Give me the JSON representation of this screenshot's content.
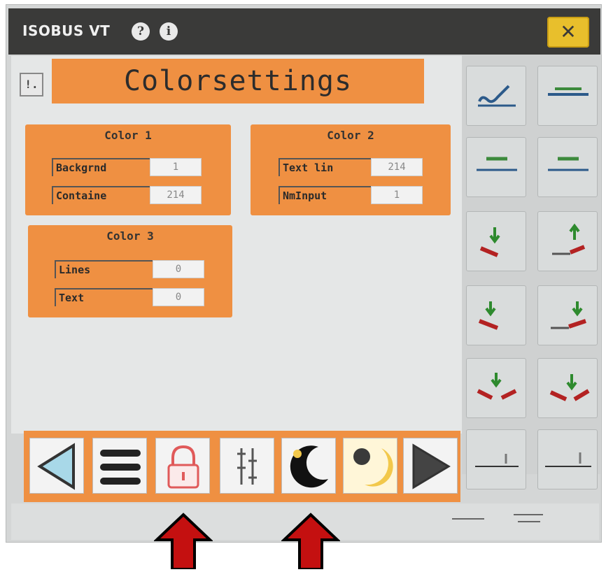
{
  "window": {
    "title": "ISOBUS VT",
    "help_icon": "question-circle-icon",
    "info_icon": "info-circle-icon",
    "close_label": "✕"
  },
  "page": {
    "info_button": "!.",
    "header": "Colorsettings"
  },
  "panels": [
    {
      "title": "Color 1",
      "fields": [
        {
          "label": "Backgrnd",
          "value": "1"
        },
        {
          "label": "Containe",
          "value": "214"
        }
      ]
    },
    {
      "title": "Color 2",
      "fields": [
        {
          "label": "Text lin",
          "value": "214"
        },
        {
          "label": "NmInput",
          "value": "1"
        }
      ]
    },
    {
      "title": "Color 3",
      "fields": [
        {
          "label": "Lines",
          "value": "0"
        },
        {
          "label": "Text",
          "value": "0"
        }
      ]
    }
  ],
  "softkeys": [
    "check-signature-icon",
    "boom-flat-icon",
    "boom-level-left-icon",
    "boom-level-right-icon",
    "left-section-down-icon",
    "right-section-up-icon",
    "left-section-lower-icon",
    "right-section-lower-icon",
    "both-sections-down-icon",
    "both-sections-fold-icon",
    "left-height-gauge-icon",
    "right-height-gauge-icon"
  ],
  "bottom_buttons": [
    "previous-page-icon",
    "menu-icon",
    "lock-icon",
    "sort-toggle-icon",
    "night-mode-icon",
    "day-mode-icon",
    "next-page-icon"
  ],
  "annotation_arrows": [
    "lock-button-pointer",
    "night-mode-pointer"
  ],
  "colors": {
    "accent_orange": "#ef9042",
    "titlebar": "#3a3a39",
    "close_yellow": "#e8bf2c",
    "arrow_red": "#c41010"
  }
}
